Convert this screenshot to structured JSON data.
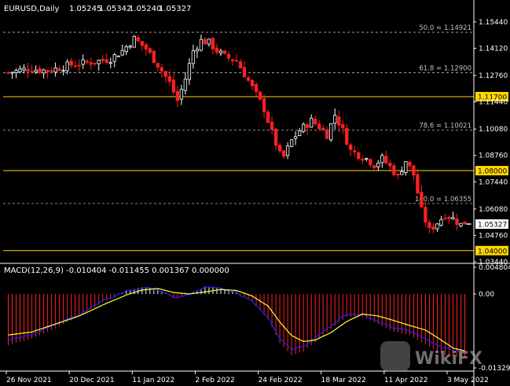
{
  "chart_data": {
    "type": "candlestick",
    "symbol_title": "EURUSD,Daily",
    "ohlc_header": [
      "1.05245",
      "1.05342",
      "1.05240",
      "1.05327"
    ],
    "price_ylim": [
      1.0344,
      1.1567
    ],
    "price_ticks": [
      "1.15440",
      "1.14120",
      "1.12760",
      "1.11440",
      "1.10080",
      "1.08760",
      "1.07440",
      "1.06080",
      "1.04760",
      "1.03440"
    ],
    "x_tick_labels": [
      "26 Nov 2021",
      "20 Dec 2021",
      "11 Jan 2022",
      "2 Feb 2022",
      "24 Feb 2022",
      "18 Mar 2022",
      "11 Apr 2022",
      "3 May 2022"
    ],
    "x_tick_bar_index": [
      0,
      16,
      32,
      48,
      64,
      80,
      96,
      112
    ],
    "fibonacci_levels": [
      {
        "label": "50.0 = 1.14921",
        "value": 1.14921
      },
      {
        "label": "61.8 = 1.12900",
        "value": 1.129
      },
      {
        "label": "78.6 = 1.10021",
        "value": 1.10021
      },
      {
        "label": "100.0 = 1.06355",
        "value": 1.06355
      }
    ],
    "horizontal_levels": [
      {
        "label": "1.11700",
        "value": 1.117
      },
      {
        "label": "1.08000",
        "value": 1.08
      },
      {
        "label": "1.04000",
        "value": 1.04
      }
    ],
    "current_price_label": "1.05327",
    "current_price": 1.05327,
    "close_path": [
      [
        0,
        1.129
      ],
      [
        5,
        1.131
      ],
      [
        10,
        1.13
      ],
      [
        16,
        1.133
      ],
      [
        22,
        1.1345
      ],
      [
        26,
        1.136
      ],
      [
        29,
        1.14
      ],
      [
        32,
        1.146
      ],
      [
        35,
        1.141
      ],
      [
        38,
        1.133
      ],
      [
        41,
        1.124
      ],
      [
        43,
        1.115
      ],
      [
        45,
        1.126
      ],
      [
        47,
        1.14
      ],
      [
        49,
        1.145
      ],
      [
        51,
        1.144
      ],
      [
        53,
        1.14
      ],
      [
        55,
        1.137
      ],
      [
        58,
        1.135
      ],
      [
        61,
        1.125
      ],
      [
        63,
        1.118
      ],
      [
        65,
        1.111
      ],
      [
        67,
        1.099
      ],
      [
        69,
        1.088
      ],
      [
        70,
        1.087
      ],
      [
        72,
        1.095
      ],
      [
        74,
        1.1
      ],
      [
        77,
        1.105
      ],
      [
        79,
        1.102
      ],
      [
        81,
        1.098
      ],
      [
        83,
        1.108
      ],
      [
        85,
        1.1
      ],
      [
        87,
        1.09
      ],
      [
        89,
        1.088
      ],
      [
        91,
        1.086
      ],
      [
        93,
        1.083
      ],
      [
        95,
        1.086
      ],
      [
        97,
        1.082
      ],
      [
        99,
        1.077
      ],
      [
        101,
        1.085
      ],
      [
        103,
        1.078
      ],
      [
        105,
        1.06
      ],
      [
        107,
        1.05
      ],
      [
        109,
        1.054
      ],
      [
        111,
        1.058
      ],
      [
        113,
        1.056
      ],
      [
        115,
        1.053
      ],
      [
        116,
        1.05327
      ]
    ],
    "macd": {
      "label": "MACD(12,26,9) -0.010404 -0.011455 0.001367 0.000000",
      "ylim": [
        -0.013299,
        0.004804
      ],
      "ticks": [
        "0.004804",
        "0.00",
        "-0.013299"
      ],
      "main_path": [
        [
          0,
          -0.0092
        ],
        [
          6,
          -0.008
        ],
        [
          12,
          -0.0062
        ],
        [
          18,
          -0.004
        ],
        [
          24,
          -0.0015
        ],
        [
          30,
          0.0006
        ],
        [
          34,
          0.0012
        ],
        [
          38,
          0.0009
        ],
        [
          42,
          -0.0008
        ],
        [
          46,
          -0.0001
        ],
        [
          50,
          0.0013
        ],
        [
          54,
          0.0011
        ],
        [
          58,
          0.0002
        ],
        [
          62,
          -0.0014
        ],
        [
          66,
          -0.0046
        ],
        [
          69,
          -0.0088
        ],
        [
          72,
          -0.011
        ],
        [
          75,
          -0.0104
        ],
        [
          78,
          -0.0086
        ],
        [
          82,
          -0.0063
        ],
        [
          86,
          -0.0041
        ],
        [
          90,
          -0.0041
        ],
        [
          94,
          -0.0054
        ],
        [
          98,
          -0.0068
        ],
        [
          102,
          -0.0074
        ],
        [
          106,
          -0.0091
        ],
        [
          110,
          -0.0107
        ],
        [
          113,
          -0.0113
        ],
        [
          116,
          -0.0114
        ]
      ],
      "signal_path": [
        [
          0,
          -0.0082
        ],
        [
          6,
          -0.0076
        ],
        [
          12,
          -0.006
        ],
        [
          18,
          -0.0044
        ],
        [
          24,
          -0.0022
        ],
        [
          30,
          -0.0002
        ],
        [
          34,
          0.0008
        ],
        [
          38,
          0.0011
        ],
        [
          42,
          0.0003
        ],
        [
          46,
          0.0
        ],
        [
          50,
          0.0004
        ],
        [
          54,
          0.0009
        ],
        [
          58,
          0.0007
        ],
        [
          62,
          -0.0004
        ],
        [
          66,
          -0.0024
        ],
        [
          69,
          -0.0056
        ],
        [
          72,
          -0.0083
        ],
        [
          75,
          -0.0095
        ],
        [
          78,
          -0.0092
        ],
        [
          82,
          -0.0077
        ],
        [
          86,
          -0.0055
        ],
        [
          90,
          -0.004
        ],
        [
          94,
          -0.0044
        ],
        [
          98,
          -0.0053
        ],
        [
          102,
          -0.0063
        ],
        [
          106,
          -0.0072
        ],
        [
          110,
          -0.0092
        ],
        [
          113,
          -0.0108
        ],
        [
          116,
          -0.0114
        ]
      ],
      "main_color": "#1e1eff",
      "signal_color": "#ffff33",
      "hist_pos_color": "#ffffff",
      "hist_neg_color": "#ff2020"
    },
    "colors": {
      "bull": "#ffffff",
      "bear": "#ff2020",
      "fib": "#b4b4b4",
      "level": "#ffd700",
      "grid_sep": "#ffffff"
    },
    "watermark": "WikiFX"
  }
}
